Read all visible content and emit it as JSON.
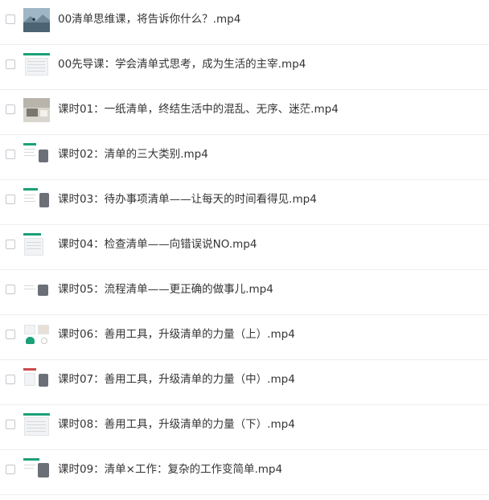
{
  "files": [
    {
      "name": "00清单思维课，将告诉你什么？.mp4",
      "thumb": "photo-landscape-icon"
    },
    {
      "name": "00先导课：学会清单式思考，成为生活的主宰.mp4",
      "thumb": "slide-table-icon"
    },
    {
      "name": "课时01：一纸清单，终结生活中的混乱、无序、迷茫.mp4",
      "thumb": "photo-desk-icon"
    },
    {
      "name": "课时02：清单的三大类别.mp4",
      "thumb": "slide-presenter-icon"
    },
    {
      "name": "课时03：待办事项清单——让每天的时间看得见.mp4",
      "thumb": "slide-presenter-icon"
    },
    {
      "name": "课时04：检查清单——向错误说NO.mp4",
      "thumb": "slide-table-icon"
    },
    {
      "name": "课时05：流程清单——更正确的做事儿.mp4",
      "thumb": "slide-presenter-icon"
    },
    {
      "name": "课时06：善用工具，升级清单的力量（上）.mp4",
      "thumb": "slide-cloud-icon"
    },
    {
      "name": "课时07：善用工具，升级清单的力量（中）.mp4",
      "thumb": "slide-presenter-icon"
    },
    {
      "name": "课时08：善用工具，升级清单的力量（下）.mp4",
      "thumb": "slide-table-icon"
    },
    {
      "name": "课时09：清单×工作：复杂的工作变简单.mp4",
      "thumb": "slide-presenter-icon"
    }
  ],
  "colors": {
    "accent": "#1aa179",
    "text": "#333333",
    "divider": "#eeeeee"
  }
}
